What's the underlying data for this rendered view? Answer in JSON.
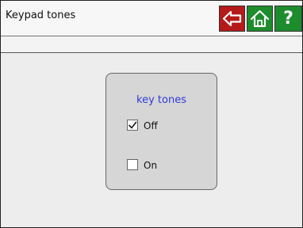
{
  "header": {
    "title": "Keypad tones",
    "buttons": [
      {
        "icon": "back-arrow-icon",
        "color": "#b51a1a"
      },
      {
        "icon": "home-icon",
        "color": "#1c8c2c"
      },
      {
        "icon": "help-icon",
        "label": "?",
        "color": "#1c8c2c"
      }
    ]
  },
  "panel": {
    "title": "key tones",
    "title_color": "#2f3bd6",
    "options": [
      {
        "label": "Off",
        "checked": true
      },
      {
        "label": "On",
        "checked": false
      }
    ]
  }
}
